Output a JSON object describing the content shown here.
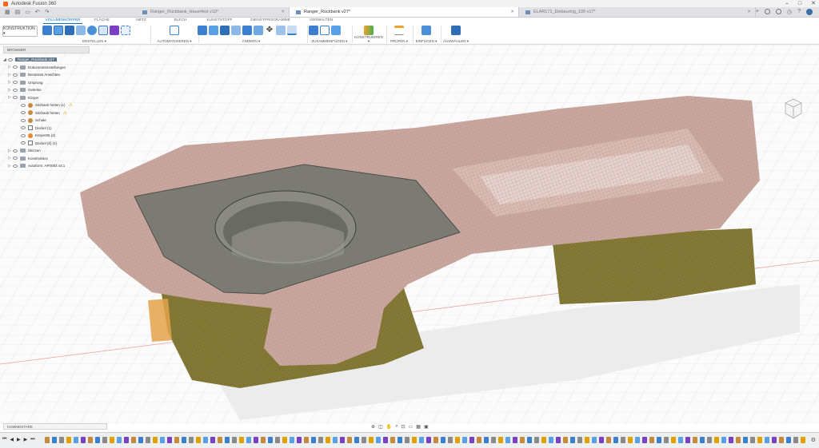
{
  "window": {
    "title": "Autodesk Fusion 360",
    "controls": [
      "–",
      "□",
      "✕"
    ]
  },
  "tabs": [
    {
      "label": "Ranger_Rückbank_Hauerfest v10*",
      "active": false
    },
    {
      "label": "Ranger_Rückbank v27*",
      "active": true
    },
    {
      "label": "ELAR171_Einbauring_100 v17*",
      "active": false
    }
  ],
  "workspace": {
    "label": "KONSTRUKTION ▾"
  },
  "ribbon": {
    "tabs": [
      "VOLUMENKÖRPER",
      "FLÄCHE",
      "NETZ",
      "BLECH",
      "KUNSTSTOFF",
      "DIENSTPROGRAMME",
      "VERWALTEN"
    ],
    "active_tab": "VOLUMENKÖRPER",
    "groups": [
      "ERSTELLEN ▾",
      "AUTOMATISIEREN ▾",
      "ÄNDERN ▾",
      "ZUSAMMENFÜGEN ▾",
      "KONSTRUIEREN ▾",
      "PRÜFEN ▾",
      "EINFÜGEN ▾",
      "AUSWÄHLEN ▾"
    ]
  },
  "browser": {
    "header": "BROWSER",
    "root": "Ranger_Rückbank v27",
    "items": [
      {
        "label": "Dokumenteinstellungen",
        "level": 1,
        "icon": "gear"
      },
      {
        "label": "Benannte Ansichten",
        "level": 1,
        "icon": "folder"
      },
      {
        "label": "Ursprung",
        "level": 1,
        "icon": "folder"
      },
      {
        "label": "Gelenke",
        "level": 1,
        "icon": "folder"
      },
      {
        "label": "Körper",
        "level": 1,
        "icon": "folder"
      },
      {
        "label": "Sitzbank hinten (1)",
        "level": 2,
        "icon": "body",
        "warning": true
      },
      {
        "label": "Sitzbank hinten",
        "level": 2,
        "icon": "body",
        "warning": true
      },
      {
        "label": "Schale",
        "level": 2,
        "icon": "body"
      },
      {
        "label": "Deckel (1)",
        "level": 2,
        "icon": "mesh"
      },
      {
        "label": "Körper55 (2)",
        "level": 2,
        "icon": "body-orange"
      },
      {
        "label": "Deckel (6) (1)",
        "level": 2,
        "icon": "mesh"
      },
      {
        "label": "Skizzen",
        "level": 1,
        "icon": "folder"
      },
      {
        "label": "Konstruktion",
        "level": 1,
        "icon": "folder"
      },
      {
        "label": "Autoform: AP0083 v3:1",
        "level": 1,
        "icon": "link"
      }
    ]
  },
  "comments": {
    "label": "KOMMENTARE"
  },
  "colors": {
    "accent": "#0a6fc2",
    "model_top": "#c9a79f",
    "model_side": "#857a36",
    "plate": "#7b7b73",
    "warning": "#e0a100"
  }
}
